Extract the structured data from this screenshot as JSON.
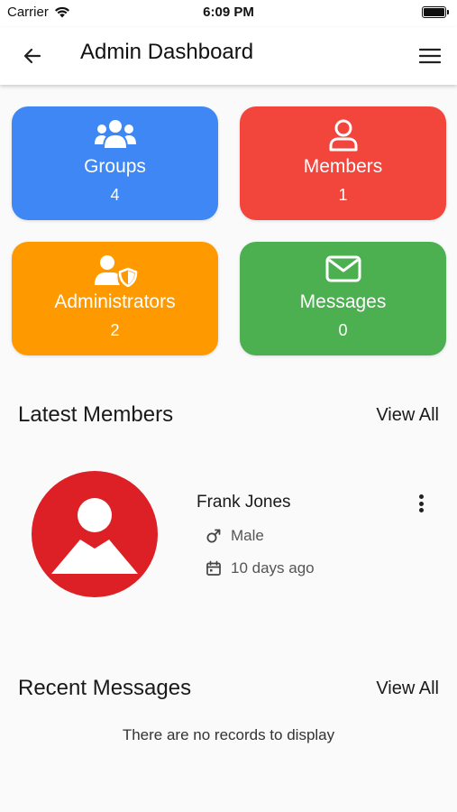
{
  "status_bar": {
    "carrier": "Carrier",
    "time": "6:09 PM"
  },
  "app_bar": {
    "title": "Admin Dashboard",
    "back_icon": "arrow-left-icon",
    "menu_icon": "hamburger-menu-icon"
  },
  "cards": [
    {
      "label": "Groups",
      "count": "4",
      "color": "#3f87f5",
      "icon": "users-icon"
    },
    {
      "label": "Members",
      "count": "1",
      "color": "#f2453c",
      "icon": "user-icon"
    },
    {
      "label": "Administrators",
      "count": "2",
      "color": "#ff9900",
      "icon": "user-shield-icon"
    },
    {
      "label": "Messages",
      "count": "0",
      "color": "#4caf50",
      "icon": "envelope-icon"
    }
  ],
  "latest_members": {
    "title": "Latest Members",
    "view_all": "View All",
    "items": [
      {
        "name": "Frank Jones",
        "gender": "Male",
        "joined": "10 days ago",
        "avatar_color": "#dd1f26"
      }
    ]
  },
  "recent_messages": {
    "title": "Recent Messages",
    "view_all": "View All",
    "empty_text": "There are no records to display"
  }
}
